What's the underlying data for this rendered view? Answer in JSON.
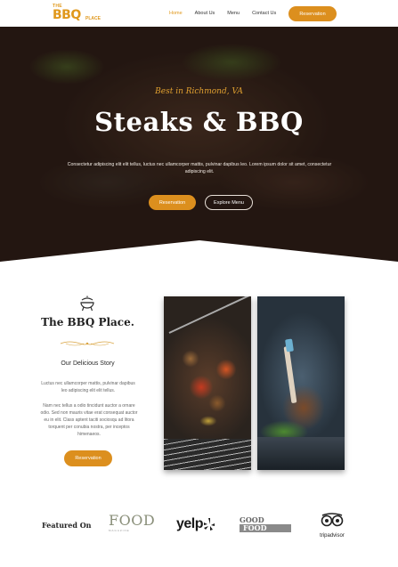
{
  "nav": {
    "logo_the": "THE",
    "logo_bbq": "BBQ",
    "logo_place": "PLACE",
    "links": [
      {
        "label": "Home",
        "active": true
      },
      {
        "label": "About Us",
        "active": false
      },
      {
        "label": "Menu",
        "active": false
      },
      {
        "label": "Contact Us",
        "active": false
      }
    ],
    "reservation_label": "Reservation"
  },
  "hero": {
    "subtitle": "Best in Richmond, VA",
    "title": "Steaks & BBQ",
    "text": "Consectetur adipiscing elit elit tellus, luctus nec ullamcorper mattis, pulvinar dapibus leo. Lorem ipsum dolor sit amet, consectetur adipiscing elit.",
    "reservation_label": "Reservation",
    "menu_label": "Explore Menu"
  },
  "story": {
    "icon": "grill-icon",
    "brand_name": "The BBQ Place.",
    "heading": "Our Delicious Story",
    "paragraph1": "Luctus nec ullamcorper mattis, pulvinar dapibus leo adipiscing elit elit tellus.",
    "paragraph2": "Nam nec tellus a odio tincidunt auctor a ornare odio. Sed non mauris vitae erat consequat auctor eu in elit. Class aptent taciti sociosqu ad litora torquent per conubia nostra, per inceptos himenaeos.",
    "reservation_label": "Reservation"
  },
  "featured": {
    "label": "Featured On",
    "logos": [
      {
        "name": "FOOD",
        "tagline": "MAGAZINE"
      },
      {
        "name": "yelp"
      },
      {
        "name_top": "GOOD",
        "name_bottom": "FOOD"
      },
      {
        "name": "tripadvisor"
      }
    ]
  },
  "colors": {
    "accent": "#dc8f1e",
    "hero_subtitle": "#e0a030",
    "heading": "#1f1f1f"
  }
}
